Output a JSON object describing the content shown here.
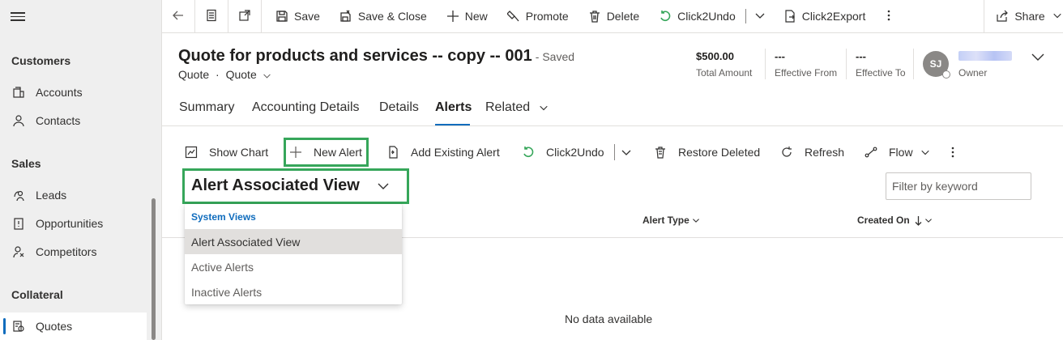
{
  "sidebar": {
    "groups": [
      {
        "label": "Customers",
        "items": [
          {
            "label": "Accounts",
            "icon": "accounts-icon"
          },
          {
            "label": "Contacts",
            "icon": "contact-icon"
          }
        ]
      },
      {
        "label": "Sales",
        "items": [
          {
            "label": "Leads",
            "icon": "leads-icon"
          },
          {
            "label": "Opportunities",
            "icon": "opportunities-icon"
          },
          {
            "label": "Competitors",
            "icon": "competitors-icon"
          }
        ]
      },
      {
        "label": "Collateral",
        "items": [
          {
            "label": "Quotes",
            "icon": "quotes-icon",
            "active": true
          }
        ]
      }
    ]
  },
  "commandbar": {
    "save": "Save",
    "save_close": "Save & Close",
    "new": "New",
    "promote": "Promote",
    "delete": "Delete",
    "click2undo": "Click2Undo",
    "click2export": "Click2Export",
    "share": "Share"
  },
  "header": {
    "title": "Quote for products and services -- copy -- 001",
    "saved": "- Saved",
    "entity": "Quote",
    "form": "Quote",
    "fields": [
      {
        "value": "$500.00",
        "label": "Total Amount"
      },
      {
        "value": "---",
        "label": "Effective From"
      },
      {
        "value": "---",
        "label": "Effective To"
      }
    ],
    "owner": {
      "initials": "SJ",
      "label": "Owner"
    }
  },
  "tabs": {
    "summary": "Summary",
    "accounting": "Accounting Details",
    "details": "Details",
    "alerts": "Alerts",
    "related": "Related"
  },
  "subgrid": {
    "show_chart": "Show Chart",
    "new_alert": "New Alert",
    "add_existing": "Add Existing Alert",
    "click2undo": "Click2Undo",
    "restore_deleted": "Restore Deleted",
    "refresh": "Refresh",
    "flow": "Flow",
    "view_name": "Alert Associated View",
    "filter_placeholder": "Filter by keyword",
    "columns": {
      "alert_type": "Alert Type",
      "created_on": "Created On"
    },
    "no_data": "No data available"
  },
  "view_dropdown": {
    "heading": "System Views",
    "items": [
      "Alert Associated View",
      "Active Alerts",
      "Inactive Alerts"
    ],
    "selected": "Alert Associated View"
  },
  "colors": {
    "accent": "#0f6cbd",
    "highlight": "#36a65a"
  }
}
